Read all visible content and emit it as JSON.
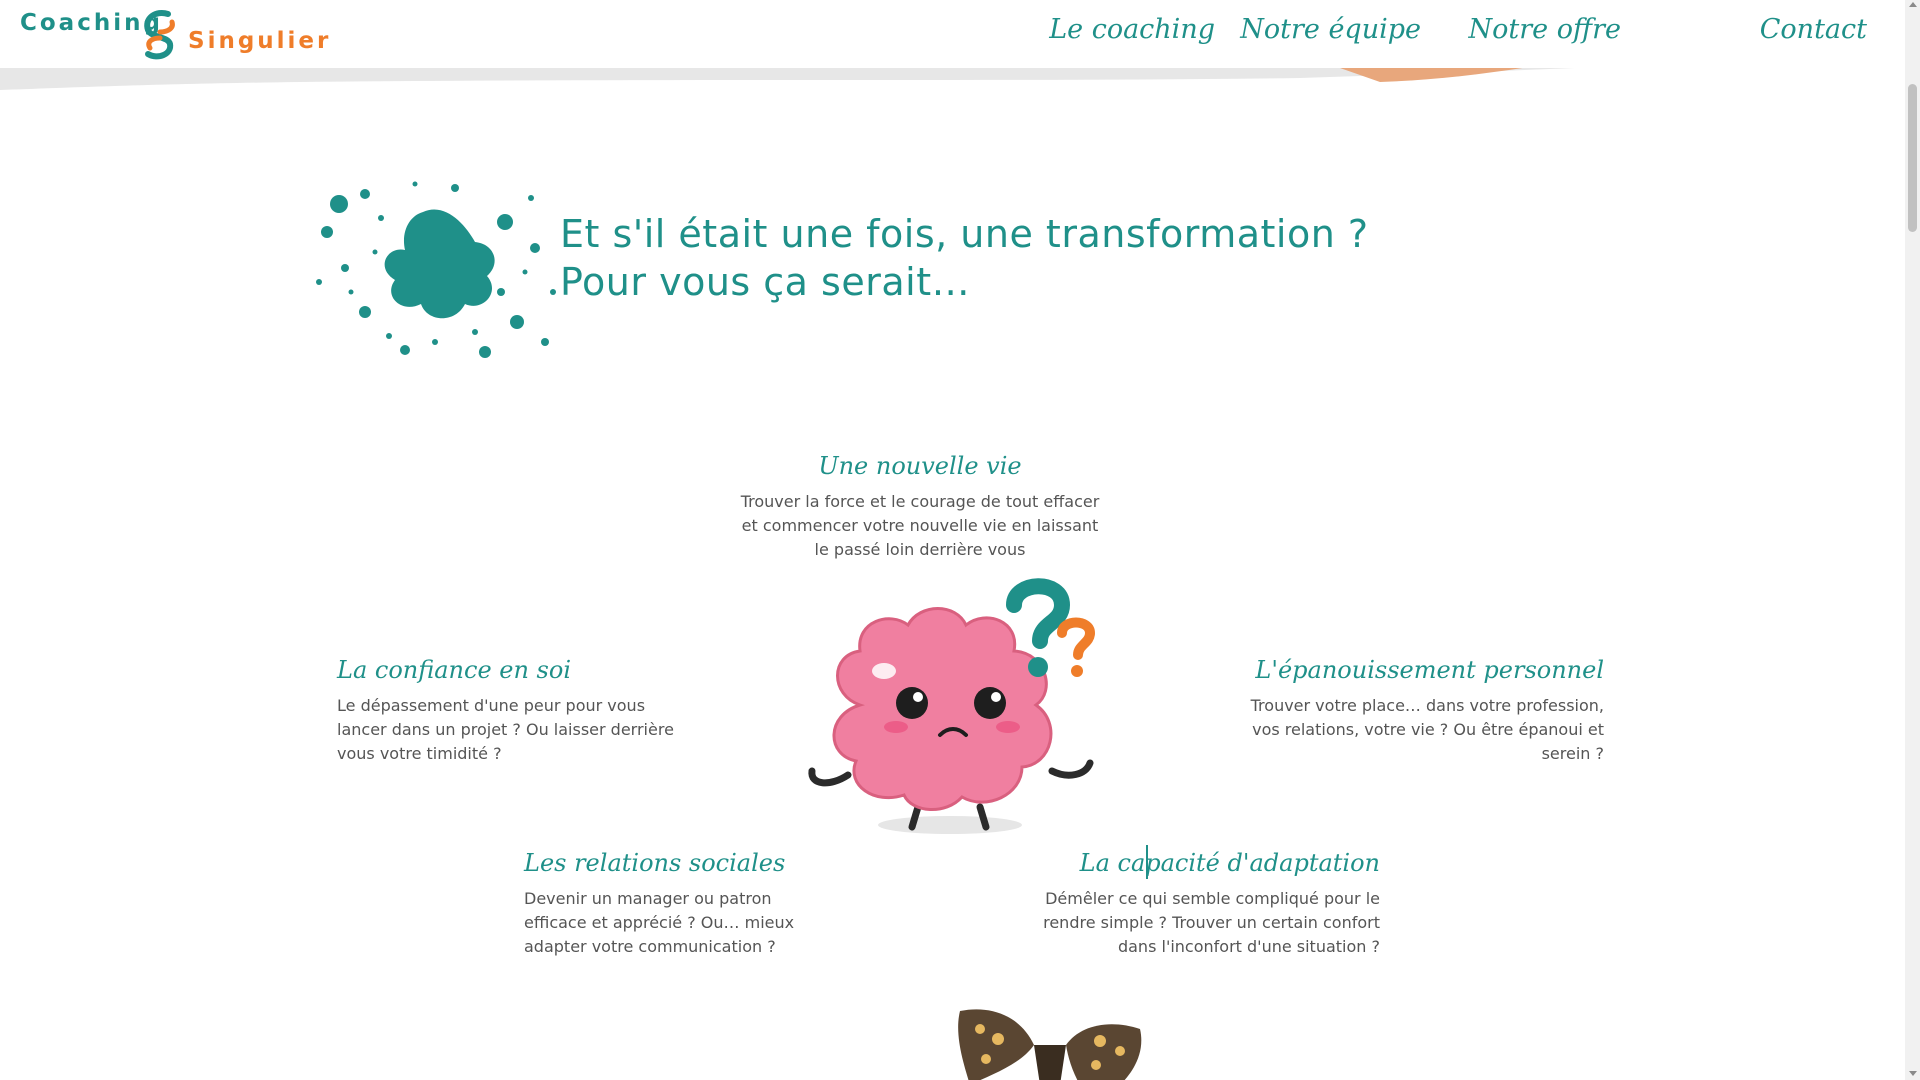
{
  "header": {
    "logo": {
      "word1": "Coaching",
      "word2": "Singulier"
    },
    "nav": [
      {
        "label": "Le coaching"
      },
      {
        "label": "Notre équipe"
      },
      {
        "label": "Notre offre"
      },
      {
        "label": "Contact"
      }
    ]
  },
  "intro": {
    "line1": "Et s'il était une fois, une transformation ?",
    "line2": "Pour vous ça serait…"
  },
  "features": {
    "new_life": {
      "title": "Une nouvelle vie",
      "text": "Trouver la force et le courage de tout effacer et commencer votre nouvelle vie en laissant le passé loin derrière vous"
    },
    "self_confidence": {
      "title": "La confiance en soi",
      "text": "Le dépassement d'une peur pour vous lancer dans un projet ? Ou laisser derrière vous votre timidité ?"
    },
    "personal_growth": {
      "title": "L'épanouissement personnel",
      "text": "Trouver votre place… dans votre profession, vos relations, votre vie ? Ou être épanoui et serein ?"
    },
    "social_relations": {
      "title": "Les relations sociales",
      "text": "Devenir un manager ou patron efficace et apprécié ? Ou… mieux adapter votre communication ?"
    },
    "adaptability": {
      "title": "La capacité d'adaptation",
      "text": "Démêler ce qui semble compliqué pour le rendre simple ? Trouver un certain confort dans l'inconfort d'une situation ?"
    }
  },
  "colors": {
    "teal": "#1f9089",
    "orange": "#ef7d2a",
    "brain_pink": "#f07fa0",
    "text": "#555555"
  },
  "icons": [
    "logo-s-mark-icon",
    "ink-splash-image",
    "confused-brain-image",
    "butterfly-image"
  ]
}
